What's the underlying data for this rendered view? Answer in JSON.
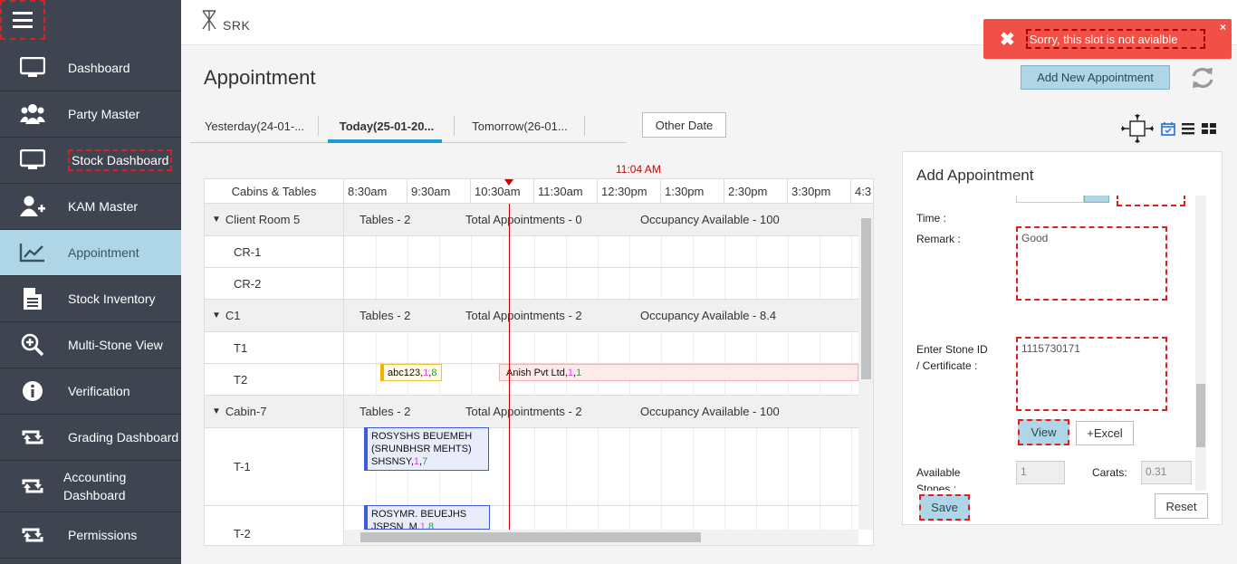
{
  "sidebar": {
    "items": [
      {
        "label": "Dashboard",
        "icon": "monitor-icon"
      },
      {
        "label": "Party Master",
        "icon": "users-icon"
      },
      {
        "label": "Stock Dashboard",
        "icon": "monitor-icon"
      },
      {
        "label": "KAM Master",
        "icon": "user-plus-icon"
      },
      {
        "label": "Appointment",
        "icon": "chart-line-icon"
      },
      {
        "label": "Stock Inventory",
        "icon": "document-icon"
      },
      {
        "label": "Multi-Stone View",
        "icon": "zoom-in-icon"
      },
      {
        "label": "Verification",
        "icon": "info-icon"
      },
      {
        "label": "Grading Dashboard",
        "icon": "retweet-icon"
      },
      {
        "label": "Accounting Dashboard",
        "icon": "retweet-icon"
      },
      {
        "label": "Permissions",
        "icon": "retweet-icon"
      }
    ]
  },
  "header": {
    "logo_text": "SRK"
  },
  "toast": {
    "message": "Sorry, this slot is not avialble",
    "close": "×",
    "icon": "✖"
  },
  "page": {
    "title": "Appointment",
    "add_button": "Add New Appointment"
  },
  "tabs": [
    {
      "label": "Yesterday(24-01-..."
    },
    {
      "label": "Today(25-01-20..."
    },
    {
      "label": "Tomorrow(26-01..."
    }
  ],
  "other_date": "Other Date",
  "scheduler": {
    "current_time": "11:04 AM",
    "first_col": "Cabins & Tables",
    "times": [
      "8:30am",
      "9:30am",
      "10:30am",
      "11:30am",
      "12:30pm",
      "1:30pm",
      "2:30pm",
      "3:30pm",
      "4:3"
    ],
    "groups": [
      {
        "name": "Client Room 5",
        "tables": "Tables - 2",
        "appointments": "Total Appointments - 0",
        "occupancy": "Occupancy Available - 100",
        "rows": [
          "CR-1",
          "CR-2"
        ]
      },
      {
        "name": "C1",
        "tables": "Tables - 2",
        "appointments": "Total Appointments - 2",
        "occupancy": "Occupancy Available - 8.4",
        "rows": [
          "T1",
          "T2"
        ]
      },
      {
        "name": "Cabin-7",
        "tables": "Tables - 2",
        "appointments": "Total Appointments - 2",
        "occupancy": "Occupancy Available - 100",
        "rows": [
          "T-1",
          "T-2"
        ]
      }
    ],
    "appointments": [
      {
        "text": "abc123,",
        "n1": "1",
        "n2": "8"
      },
      {
        "text": "Anish Pvt Ltd,",
        "n1": "1",
        "n2": "1"
      },
      {
        "text": "ROSYSHS BEUEMEH (SRUNBHSR MEHTS) SHSNSY,",
        "n1": "1",
        "n2": "7"
      },
      {
        "text": "ROSYMR. BEUEJHS JSPSN_M,",
        "n1": "1",
        "n2": "8"
      }
    ]
  },
  "form": {
    "title": "Add Appointment",
    "time_label": "Time :",
    "remark_label": "Remark :",
    "remark_value": "Good",
    "stone_label": "Enter Stone ID / Certificate :",
    "stone_value": "1115730171",
    "view_button": "View",
    "excel_button": "+Excel",
    "available_label": "Available Stones :",
    "available_value": "1",
    "carats_label": "Carats:",
    "carats_value": "0.31",
    "save_button": "Save",
    "reset_button": "Reset"
  }
}
